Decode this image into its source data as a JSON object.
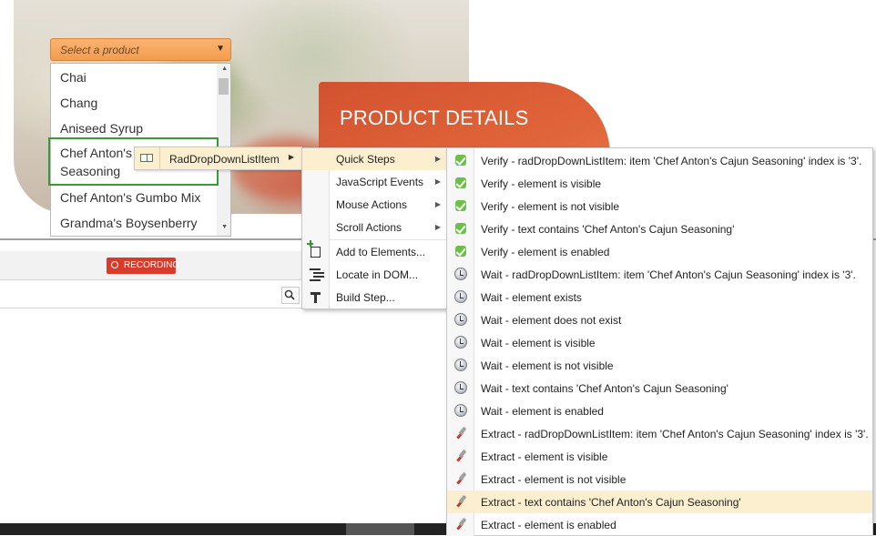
{
  "page": {
    "section_title": "PRODUCT DETAILS",
    "dropdown": {
      "placeholder": "Select a product",
      "items": [
        "Chai",
        "Chang",
        "Aniseed Syrup",
        "Chef Anton's Seasoning",
        "Chef Anton's Gumbo Mix",
        "Grandma's Boysenberry"
      ],
      "highlighted_item_lines": [
        "Chef Anton's",
        "Seasoning"
      ]
    }
  },
  "recorder": {
    "recording_label": "RECORDING"
  },
  "element_chip": {
    "label": "RadDropDownListItem"
  },
  "actions_menu": {
    "items": [
      {
        "label": "Quick Steps",
        "icon": "",
        "submenu": true
      },
      {
        "label": "JavaScript Events",
        "icon": "",
        "submenu": true
      },
      {
        "label": "Mouse Actions",
        "icon": "",
        "submenu": true
      },
      {
        "label": "Scroll Actions",
        "icon": "",
        "submenu": true
      },
      {
        "label": "Add to Elements...",
        "icon": "add-element-icon"
      },
      {
        "label": "Locate in DOM...",
        "icon": "dom-tree-icon"
      },
      {
        "label": "Build Step...",
        "icon": "build-hammer-icon"
      }
    ]
  },
  "quick_steps": {
    "items": [
      {
        "label": "Verify - radDropDownListItem: item 'Chef Anton's Cajun Seasoning' index is '3'.",
        "icon": "verify-check-icon"
      },
      {
        "label": "Verify - element is visible",
        "icon": "verify-check-icon"
      },
      {
        "label": "Verify - element is not visible",
        "icon": "verify-check-icon"
      },
      {
        "label": "Verify - text contains 'Chef Anton's Cajun Seasoning'",
        "icon": "verify-check-icon"
      },
      {
        "label": "Verify - element is enabled",
        "icon": "verify-check-icon"
      },
      {
        "label": "Wait - radDropDownListItem: item 'Chef Anton's Cajun Seasoning' index is '3'.",
        "icon": "wait-clock-icon"
      },
      {
        "label": "Wait - element exists",
        "icon": "wait-clock-icon"
      },
      {
        "label": "Wait - element does not exist",
        "icon": "wait-clock-icon"
      },
      {
        "label": "Wait - element is visible",
        "icon": "wait-clock-icon"
      },
      {
        "label": "Wait - element is not visible",
        "icon": "wait-clock-icon"
      },
      {
        "label": "Wait - text contains 'Chef Anton's Cajun Seasoning'",
        "icon": "wait-clock-icon"
      },
      {
        "label": "Wait - element is enabled",
        "icon": "wait-clock-icon"
      },
      {
        "label": "Extract - radDropDownListItem: item 'Chef Anton's Cajun Seasoning' index is '3'.",
        "icon": "extract-dropper-icon"
      },
      {
        "label": "Extract - element is visible",
        "icon": "extract-dropper-icon"
      },
      {
        "label": "Extract - element is not visible",
        "icon": "extract-dropper-icon"
      },
      {
        "label": "Extract - text contains 'Chef Anton's Cajun Seasoning'",
        "icon": "extract-dropper-icon"
      },
      {
        "label": "Extract - element is enabled",
        "icon": "extract-dropper-icon"
      }
    ]
  },
  "colors": {
    "dropdown_accent": "#f39c4f",
    "panel_accent": "#e1653a",
    "recording_red": "#d93b2b",
    "menu_highlight": "#fbefd0",
    "highlight_border": "#3a9a3a"
  }
}
